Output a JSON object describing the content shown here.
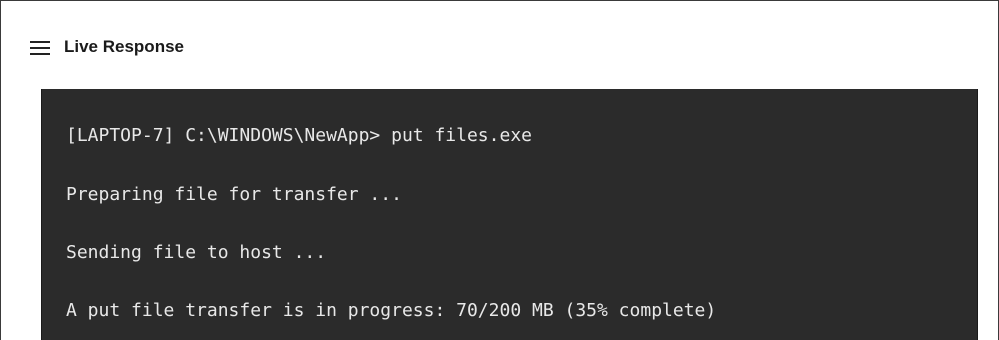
{
  "header": {
    "title": "Live Response",
    "menu_icon": "hamburger-menu-icon"
  },
  "console": {
    "lines": [
      "[LAPTOP-7] C:\\WINDOWS\\NewApp> put files.exe",
      "Preparing file for transfer ...",
      "Sending file to host ...",
      "A put file transfer is in progress: 70/200 MB (35% complete)"
    ],
    "background_color": "#2b2b2b",
    "text_color": "#e8e8e8"
  }
}
